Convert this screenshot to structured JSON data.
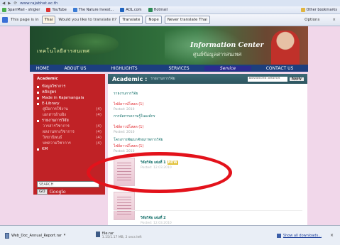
{
  "browser": {
    "address": "www.rajabhat.ac.th",
    "bookmarks": [
      "SparrMail - shigler",
      "YouTube",
      "The Nature Invest...",
      "AOL.com",
      "Hotmail",
      "Other bookmarks"
    ],
    "translate_bar": {
      "message_prefix": "This page is in",
      "language": "Thai",
      "question": "Would you like to translate it?",
      "translate_btn": "Translate",
      "nope_btn": "Nope",
      "never_btn": "Never translate Thai",
      "options": "Options",
      "close": "×"
    }
  },
  "banner": {
    "thai_title": "เทคโนโลยีสารสนเทศ",
    "title": "Information Center",
    "subtitle": "ศูนย์ข้อมูลสารสนเทศ"
  },
  "nav": [
    "HOME",
    "ABOUT US",
    "HIGHLIGHTS",
    "SERVICES",
    "Service",
    "CONTACT US"
  ],
  "sidebar": {
    "heading": "Academic",
    "items": [
      {
        "label": "ข้อมูลวิชาการ",
        "count": "",
        "sub": false
      },
      {
        "label": "หลักสูตร",
        "count": "",
        "sub": false
      },
      {
        "label": "Made in Rajamangala",
        "count": "",
        "sub": false
      },
      {
        "label": "E-Library",
        "count": "",
        "sub": false
      },
      {
        "label": "คู่มือการใช้งาน",
        "count": "(4)",
        "sub": true
      },
      {
        "label": "เอกสารอ้างอิง",
        "count": "(4)",
        "sub": true
      },
      {
        "label": "รายงานการวิจัย",
        "count": "",
        "sub": false
      },
      {
        "label": "วารสารวิชาการ",
        "count": "(4)",
        "sub": true
      },
      {
        "label": "ผลงานทางวิชาการ",
        "count": "(4)",
        "sub": true
      },
      {
        "label": "วิทยานิพนธ์",
        "count": "(4)",
        "sub": true
      },
      {
        "label": "บทความวิชาการ",
        "count": "(4)",
        "sub": true
      },
      {
        "label": "KM",
        "count": "",
        "sub": false
      }
    ],
    "search_placeholder": "SEARCH",
    "go": "GO",
    "google": "Google"
  },
  "main": {
    "title": "Academic :",
    "crumb": "รายงานการวิจัย",
    "search_placeholder": "Advanced Search",
    "search_btn": "Apply",
    "entries": [
      {
        "title": "รายงานการวิจัย",
        "link": "",
        "date": ""
      },
      {
        "title": "",
        "link": "ไฟล์ดาวน์โหลด (1)",
        "date": "Posted: 2010"
      },
      {
        "title": "การจัดการความรู้ในองค์กร",
        "link": "",
        "date": ""
      },
      {
        "title": "",
        "link": "ไฟล์ดาวน์โหลด (1)",
        "date": "Posted: 2010"
      },
      {
        "title": "โครงการพัฒนาศักยภาพการวิจัย",
        "link": "ไฟล์ดาวน์โหลด (1)",
        "date": "Posted: 2010"
      }
    ],
    "cards": [
      {
        "title": "วิจัยวิจัย เล่มที่ 1",
        "badge": "NEW",
        "meta": "Posted: 12.03.2010"
      },
      {
        "title": "วิจัยวิจัย เล่มที่ 2",
        "badge": "",
        "meta": "Posted: 12.03.2010"
      }
    ]
  },
  "downloads": {
    "file1": "Web_Doc_Annual_Report.rar",
    "file2_name": "file.rar",
    "file2_status": "1.15/1.17 MB, 2 secs left",
    "show_all": "Show all downloads...",
    "close": "×"
  }
}
